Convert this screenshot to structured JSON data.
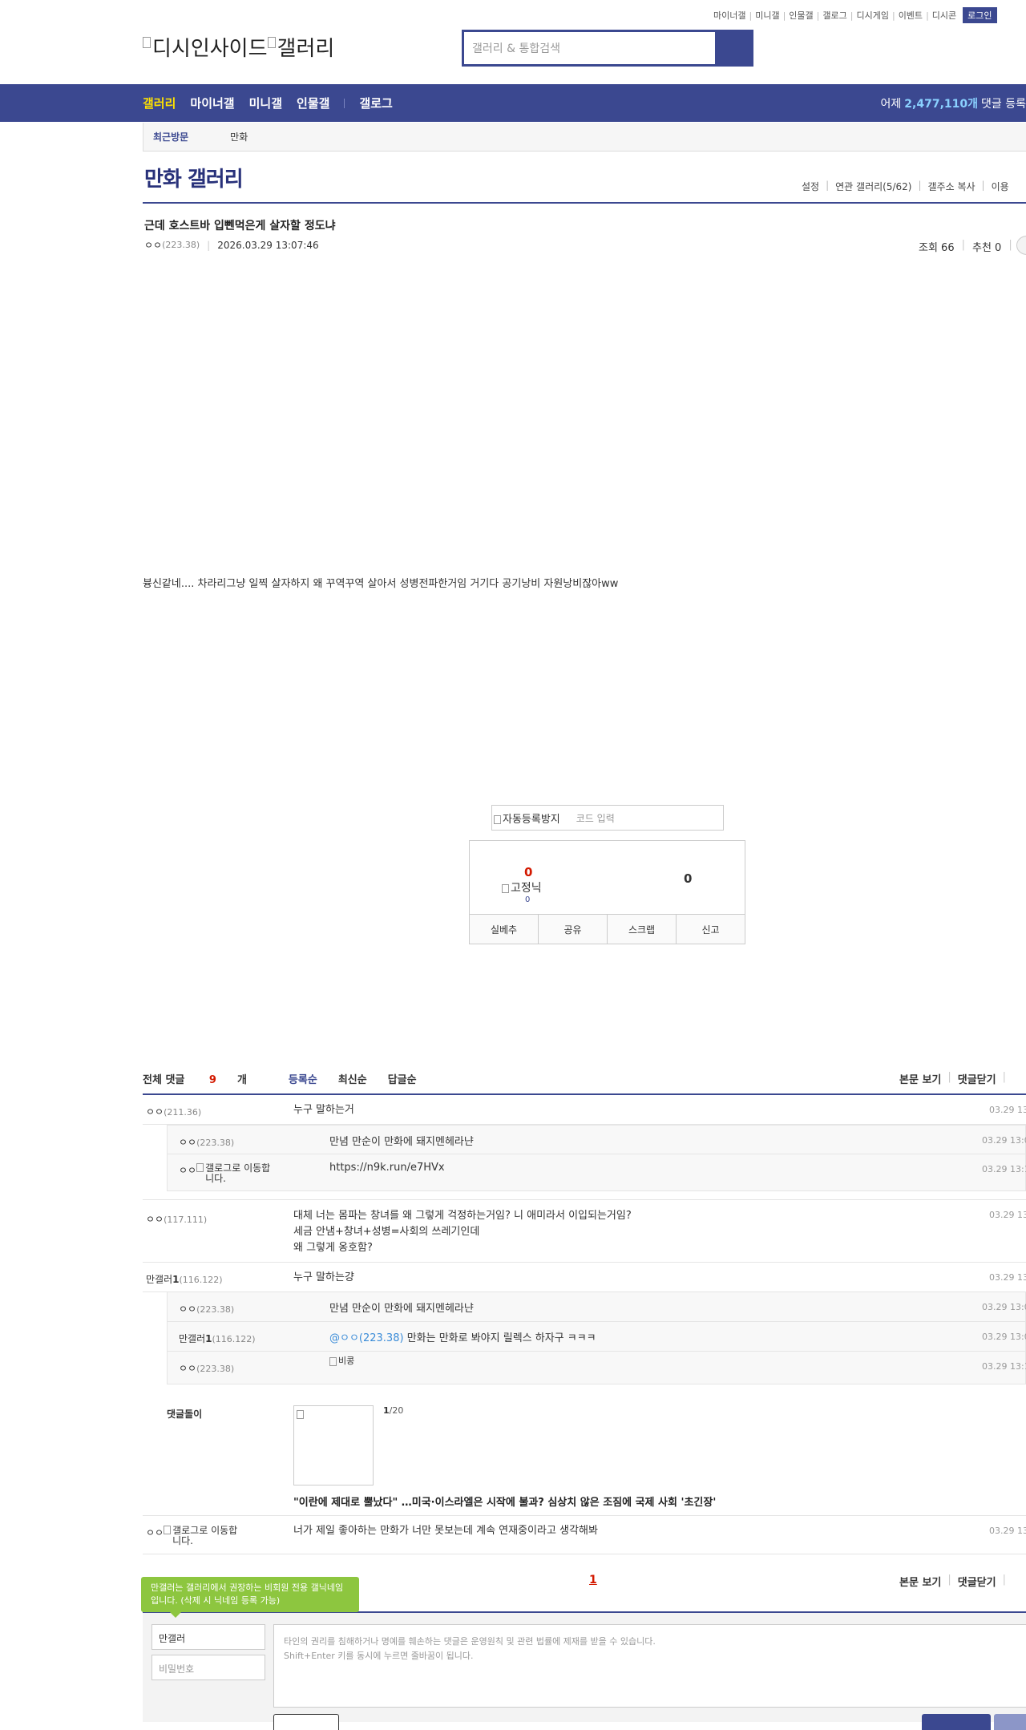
{
  "top_util": [
    "마이너갤",
    "미니갤",
    "인물갤",
    "갤로그",
    "디시게임",
    "이벤트",
    "디시콘"
  ],
  "login_label": "로그인",
  "logo": {
    "part1": "디시인사이드",
    "part2": "갤러리"
  },
  "search": {
    "placeholder": "갤러리 & 통합검색"
  },
  "gnb": {
    "items": [
      "갤러리",
      "마이너갤",
      "미니갤",
      "인물갤",
      "갤로그"
    ],
    "stat_prefix": "어제",
    "stat_value": "2,477,110개",
    "stat_suffix": "댓글 등록"
  },
  "recent": {
    "label": "최근방문",
    "item": "만화"
  },
  "gallery": {
    "title": "만화 갤러리",
    "links": [
      "설정",
      "연관 갤러리(5/62)",
      "갤주소 복사",
      "이용"
    ]
  },
  "post": {
    "title": "근데 호스트바 입뻰먹은게 살자할 정도냐",
    "nick": "ㅇㅇ",
    "ip": "(223.38)",
    "date": "2026.03.29 13:07:46",
    "views": "조회 66",
    "recommend": "추천 0",
    "body": "븅신같네.... 차라리그냥 일찍 살자하지 왜 꾸역꾸역 살아서 성병전파한거임 거기다 공기낭비 자원낭비잖아ww"
  },
  "captcha": {
    "img_alt": "자동등록방지",
    "placeholder": "코드 입력"
  },
  "recommend_box": {
    "up": "0",
    "fixed_alt": "고정닉",
    "fixed_count": "0",
    "down": "0",
    "buttons": [
      "실베추",
      "공유",
      "스크랩",
      "신고"
    ]
  },
  "comments_head": {
    "total_prefix": "전체 댓글 ",
    "total_count": "9",
    "total_suffix": "개",
    "sort": [
      "등록순",
      "최신순",
      "답글순"
    ],
    "right": [
      "본문 보기",
      "댓글닫기"
    ]
  },
  "comments": [
    {
      "nick": "ㅇㅇ",
      "ip": "(211.36)",
      "text": "누구 말하는거",
      "date": "03.29 13"
    },
    {
      "nick": "ㅇㅇ",
      "ip": "(223.38)",
      "text": "만념 만순이 만화에 돼지멘헤라냔",
      "date": "03.29 13:0"
    },
    {
      "nick": "ㅇㅇ",
      "img_alt": "갤로그로 이동합니다.",
      "text": "https://n9k.run/e7HVx",
      "date": "03.29 13:1"
    },
    {
      "nick": "ㅇㅇ",
      "ip": "(117.111)",
      "lines": [
        "대체 너는 몸파는 창녀를 왜 그렇게 걱정하는거임? 니 애미라서 이입되는거임?",
        "세금 안냄+창녀+성병=사회의 쓰레기인데",
        "왜 그렇게 옹호함?"
      ],
      "date": "03.29 13"
    },
    {
      "nick_main": "만갤러",
      "nick_num": "1",
      "ip": "(116.122)",
      "text": "누구 말하는걍",
      "date": "03.29 13"
    },
    {
      "nick": "ㅇㅇ",
      "ip": "(223.38)",
      "text": "만념 만순이 만화에 돼지멘헤라냔",
      "date": "03.29 13:0"
    },
    {
      "nick_main": "만갤러",
      "nick_num": "1",
      "ip": "(116.122)",
      "at": "@ㅇㅇ(223.38)",
      "text": " 만화는 만화로 봐야지 릴렉스 하자구 ㅋㅋㅋ",
      "date": "03.29 13:0"
    },
    {
      "nick": "ㅇㅇ",
      "ip": "(223.38)",
      "img_alt": "비콩",
      "date": "03.29 13:1"
    },
    {
      "nick": "ㅇㅇ",
      "img_alt": "갤로그로 이동합니다.",
      "text": "너가 제일 좋아하는 만화가 너만 못보는데 계속 연재중이라고 생각해봐",
      "date": "03.29 13"
    }
  ],
  "ad": {
    "label": "댓글돌이",
    "page_cur": "1",
    "page_total": "/20",
    "headline": "\"이란에 제대로 뿔났다\" …미국·이스라엘은 시작에 불과? 심상치 않은 조짐에 국제 사회 '초긴장'"
  },
  "paging": "1",
  "bottom_links": [
    "본문 보기",
    "댓글닫기"
  ],
  "write": {
    "tip": "만갤러는 갤러리에서 권장하는 비회원 전용 갤닉네임입니다. (삭제 시 닉네임 등록 가능)",
    "nick_value": "만갤러",
    "pw_placeholder": "비밀번호",
    "ta_line1": "타인의 권리를 침해하거나 명예를 훼손하는 댓글은 운영원칙 및 관련 법률에 제재를 받을 수 있습니다.",
    "ta_line2": "Shift+Enter 키를 동시에 누르면 줄바꿈이 됩니다."
  },
  "colors": {
    "brand": "#3b4890",
    "accent_red": "#d31900",
    "highlight": "#ffe200"
  }
}
